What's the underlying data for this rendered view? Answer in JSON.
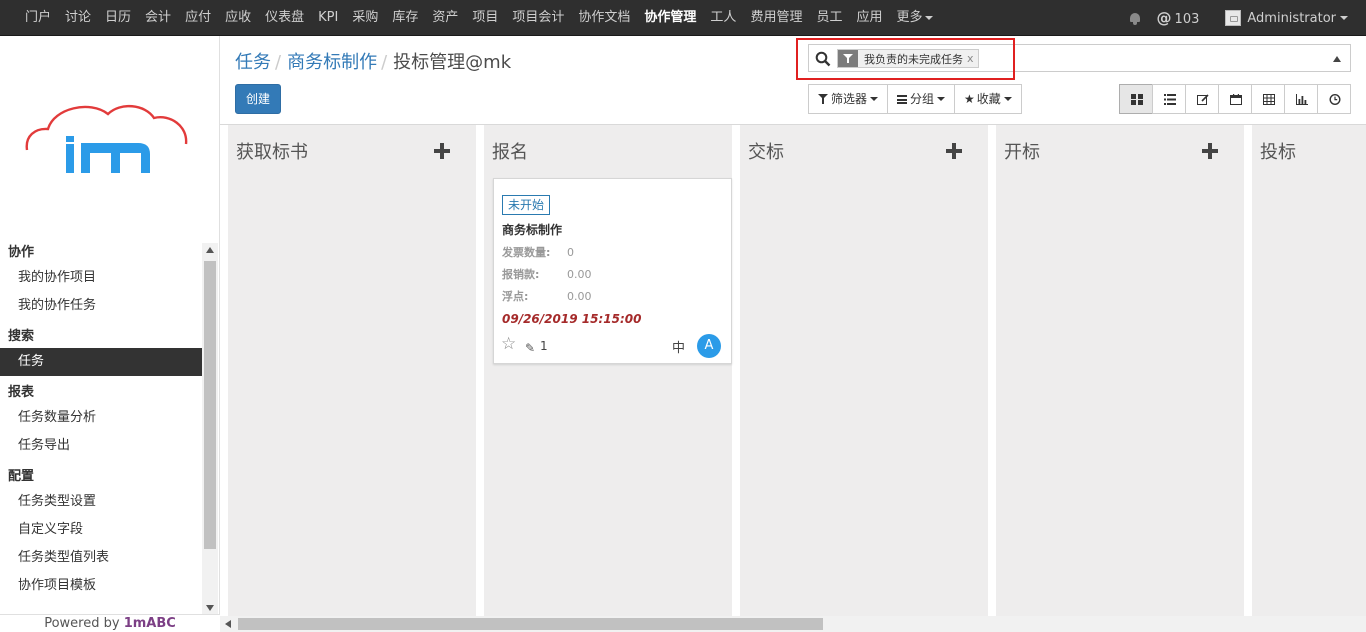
{
  "topbar": {
    "menu": [
      "门户",
      "讨论",
      "日历",
      "会计",
      "应付",
      "应收",
      "仪表盘",
      "KPI",
      "采购",
      "库存",
      "资产",
      "项目",
      "项目会计",
      "协作文档",
      "协作管理",
      "工人",
      "费用管理",
      "员工",
      "应用",
      "更多"
    ],
    "active_menu": "协作管理",
    "mentions_count": "103",
    "user_name": "Administrator"
  },
  "sidebar": {
    "logo_text": "1m",
    "sections": [
      {
        "title": "协作",
        "items": [
          "我的协作项目",
          "我的协作任务"
        ]
      },
      {
        "title": "搜索",
        "items": [
          "任务"
        ]
      },
      {
        "title": "报表",
        "items": [
          "任务数量分析",
          "任务导出"
        ]
      },
      {
        "title": "配置",
        "items": [
          "任务类型设置",
          "自定义字段",
          "任务类型值列表",
          "协作项目模板"
        ]
      }
    ],
    "active_item": "任务",
    "powered_prefix": "Powered by",
    "powered_brand": "1mABC"
  },
  "breadcrumb": {
    "items": [
      "任务",
      "商务标制作"
    ],
    "current": "投标管理@mk"
  },
  "buttons": {
    "create": "创建",
    "filters": "筛选器",
    "group_by": "分组",
    "favorites": "收藏"
  },
  "search": {
    "facet_value": "我负责的未完成任务",
    "facet_remove": "x"
  },
  "views": [
    "kanban",
    "list",
    "form",
    "calendar",
    "pivot",
    "graph",
    "activity"
  ],
  "active_view": "kanban",
  "kanban": {
    "columns": [
      {
        "title": "获取标书",
        "add": true
      },
      {
        "title": "报名",
        "add": false
      },
      {
        "title": "交标",
        "add": true
      },
      {
        "title": "开标",
        "add": true
      },
      {
        "title": "投标",
        "add": false
      }
    ],
    "card": {
      "status_tag": "未开始",
      "title": "商务标制作",
      "fields": [
        {
          "label": "发票数量:",
          "value": "0"
        },
        {
          "label": "报销款:",
          "value": "0.00"
        },
        {
          "label": "浮点:",
          "value": "0.00"
        }
      ],
      "deadline": "09/26/2019 15:15:00",
      "attachments": "1",
      "priority": "中",
      "assignee_initial": "A"
    }
  }
}
